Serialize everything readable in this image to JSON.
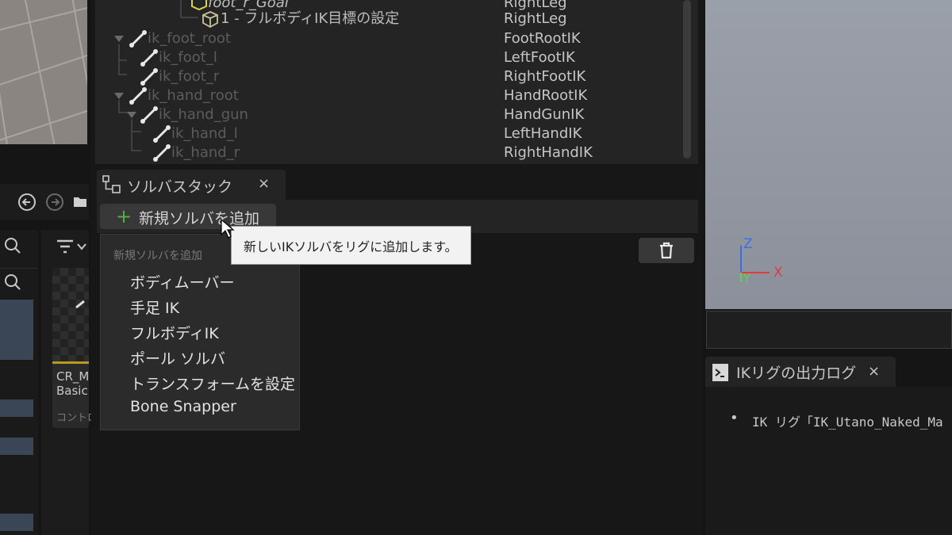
{
  "hierarchy": {
    "rows": [
      {
        "name": "foot_r_Goal",
        "chain": "RightLeg",
        "kind": "goal"
      },
      {
        "name": "1 - フルボディIK目標の設定",
        "chain": "RightLeg",
        "kind": "solver-goal"
      },
      {
        "name": "ik_foot_root",
        "chain": "FootRootIK",
        "kind": "bone"
      },
      {
        "name": "ik_foot_l",
        "chain": "LeftFootIK",
        "kind": "bone"
      },
      {
        "name": "ik_foot_r",
        "chain": "RightFootIK",
        "kind": "bone"
      },
      {
        "name": "ik_hand_root",
        "chain": "HandRootIK",
        "kind": "bone"
      },
      {
        "name": "ik_hand_gun",
        "chain": "HandGunIK",
        "kind": "bone"
      },
      {
        "name": "ik_hand_l",
        "chain": "LeftHandIK",
        "kind": "bone"
      },
      {
        "name": "ik_hand_r",
        "chain": "RightHandIK",
        "kind": "bone"
      }
    ]
  },
  "solver_stack": {
    "tab_title": "ソルバスタック",
    "close_symbol": "×",
    "add_button_label": "新規ソルバを追加",
    "add_button_icon": "plus-icon",
    "delete_icon": "trash-icon"
  },
  "dropdown": {
    "header": "新規ソルバを追加",
    "items": [
      "ボディムーバー",
      "手足 IK",
      "フルボディIK",
      "ポール ソルバ",
      "トランスフォームを設定",
      "Bone Snapper"
    ]
  },
  "tooltip": {
    "text": "新しいIKソルバをリグに追加します。"
  },
  "content_browser": {
    "asset_name_1": "CR_M",
    "asset_name_2": "Basic",
    "asset_type": "コントロ"
  },
  "viewport": {
    "axis_z": "Z",
    "axis_x": "X",
    "axis_y": "Y"
  },
  "output_log": {
    "tab_title": "IKリグの出力ログ",
    "close_symbol": "×",
    "bullet": "•",
    "line": "IK リグ「IK_Utano_Naked_Ma"
  },
  "colors": {
    "accent_green": "#52b043",
    "axis_red": "#e03a3a",
    "axis_blue": "#3a6ee8",
    "axis_green": "#5fd34a",
    "goal_yellow": "#d9d24a"
  }
}
